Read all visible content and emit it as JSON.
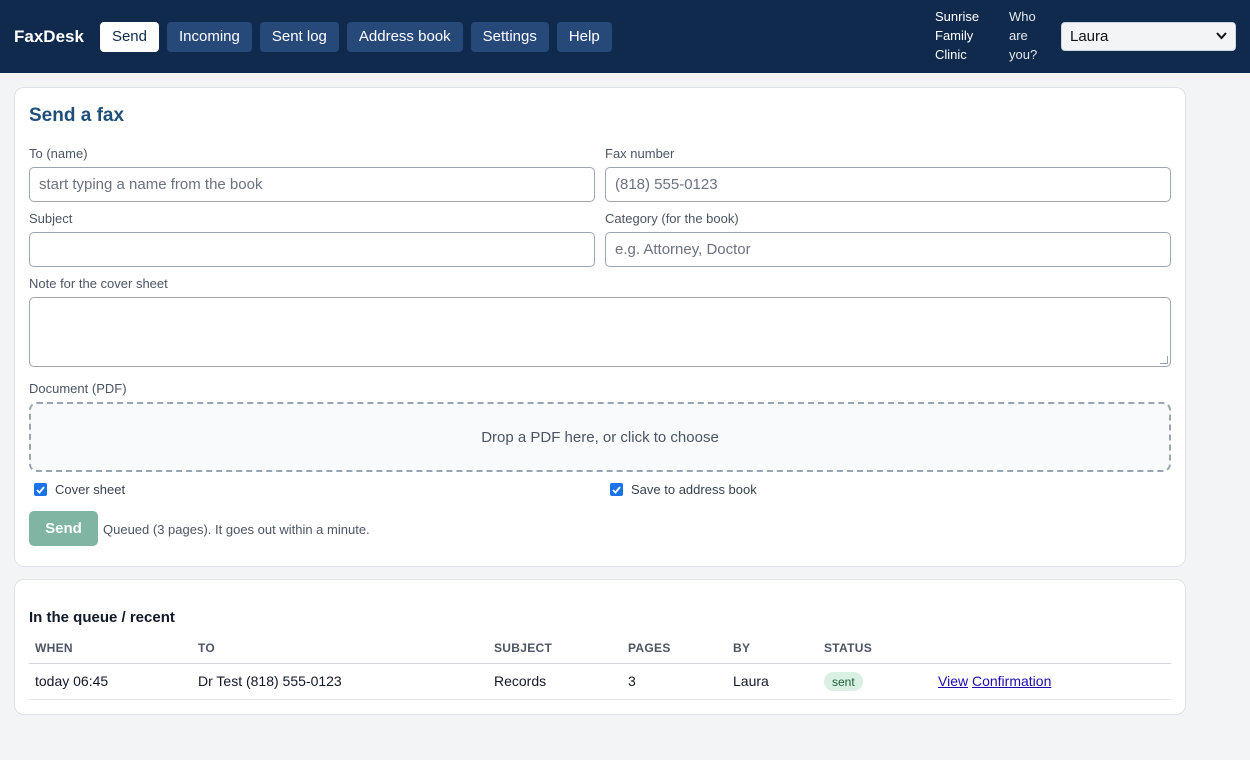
{
  "app": {
    "title": "FaxDesk"
  },
  "nav": {
    "items": [
      {
        "label": "Send"
      },
      {
        "label": "Incoming"
      },
      {
        "label": "Sent log"
      },
      {
        "label": "Address book"
      },
      {
        "label": "Settings"
      },
      {
        "label": "Help"
      }
    ],
    "active": "Send"
  },
  "header": {
    "clinic_line1": "Sunrise",
    "clinic_line2": "Family",
    "clinic_line3": "Clinic",
    "who_line1": "Who",
    "who_line2": "are",
    "who_line3": "you?",
    "user_selected": "Laura"
  },
  "send_form": {
    "title": "Send a fax",
    "to_label": "To (name)",
    "to_placeholder": "start typing a name from the book",
    "fax_label": "Fax number",
    "fax_placeholder": "(818) 555-0123",
    "subject_label": "Subject",
    "subject_value": "",
    "category_label": "Category (for the book)",
    "category_placeholder": "e.g. Attorney, Doctor",
    "note_label": "Note for the cover sheet",
    "note_value": "",
    "document_label": "Document (PDF)",
    "dropzone_text": "Drop a PDF here, or click to choose",
    "cover_sheet_label": "Cover sheet",
    "cover_sheet_checked": true,
    "save_book_label": "Save to address book",
    "save_book_checked": true,
    "send_label": "Send",
    "status_message": "Queued (3 pages). It goes out within a minute."
  },
  "queue": {
    "title": "In the queue / recent",
    "columns": [
      "WHEN",
      "TO",
      "SUBJECT",
      "PAGES",
      "BY",
      "STATUS"
    ],
    "rows": [
      {
        "when": "today 06:45",
        "to": "Dr Test (818) 555-0123",
        "subject": "Records",
        "pages": "3",
        "by": "Laura",
        "status": "sent",
        "action_view": "View",
        "action_confirmation": "Confirmation"
      }
    ]
  },
  "colors": {
    "topbar": "#0f2a4d",
    "nav_button": "#27497a",
    "title_blue": "#1f4e79",
    "send_button": "#7fb5a2",
    "status_badge_bg": "#d9f0e3"
  },
  "icons": {
    "select_chevron": "chevron-down-icon",
    "checkbox_check": "check-icon"
  }
}
